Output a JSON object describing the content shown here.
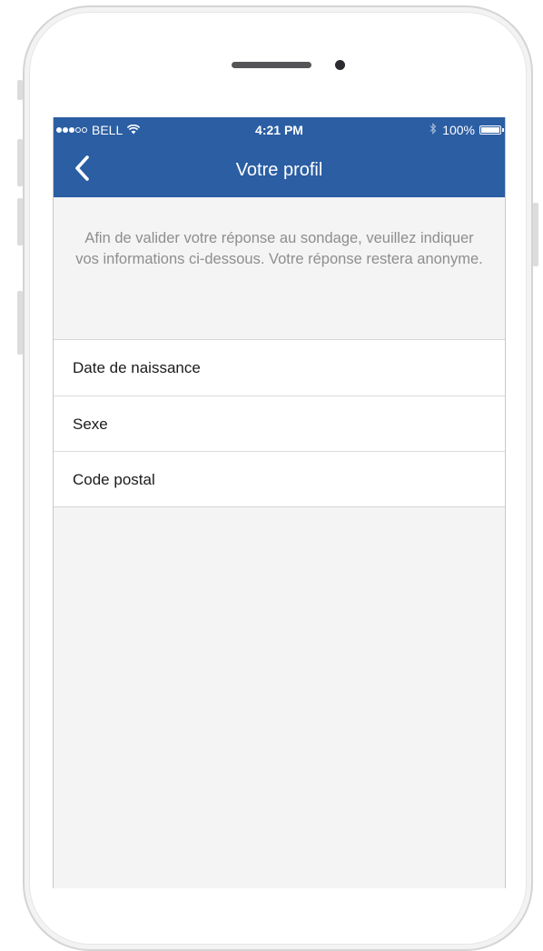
{
  "status_bar": {
    "carrier": "BELL",
    "time": "4:21 PM",
    "battery": "100%",
    "signal_dots_filled": 3,
    "signal_dots_total": 5
  },
  "nav": {
    "title": "Votre profil",
    "back_icon": "chevron-left-icon"
  },
  "intro": {
    "text": "Afin de valider votre réponse au sondage, veuillez indiquer vos informations ci-dessous. Votre réponse restera anonyme."
  },
  "form": {
    "fields": [
      {
        "label": "Date de naissance"
      },
      {
        "label": "Sexe"
      },
      {
        "label": "Code postal"
      }
    ]
  },
  "colors": {
    "header": "#2b5ea3",
    "background": "#f4f4f4",
    "row_background": "#ffffff",
    "intro_text": "#8e8e8e"
  }
}
